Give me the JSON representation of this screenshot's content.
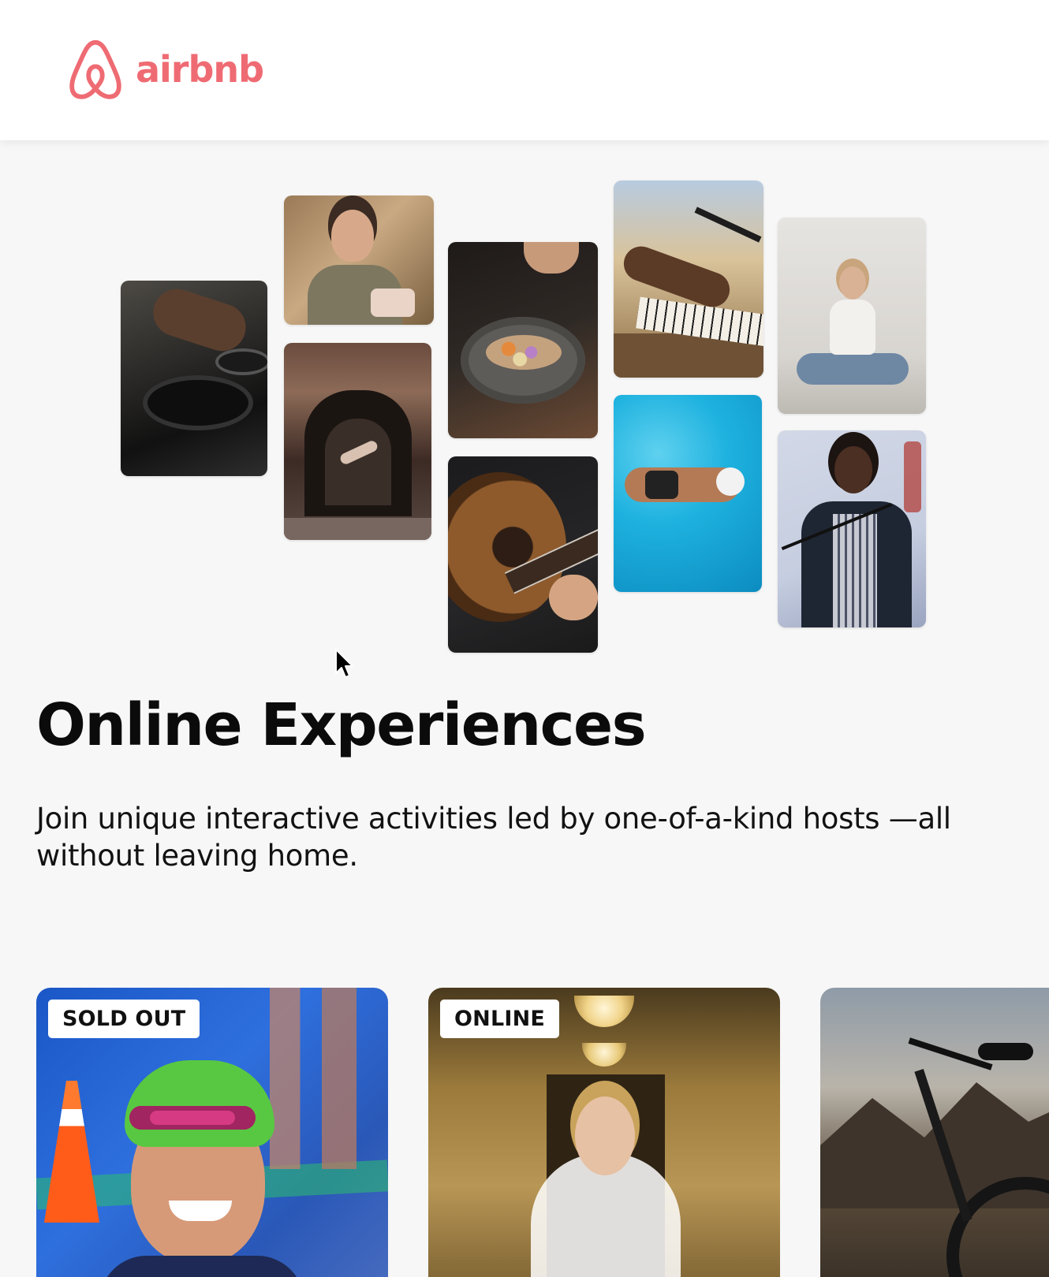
{
  "brand": {
    "name": "airbnb",
    "color": "#ef6b73"
  },
  "collage": {
    "tiles": [
      {
        "subject": "cooking"
      },
      {
        "subject": "baking"
      },
      {
        "subject": "dance"
      },
      {
        "subject": "food"
      },
      {
        "subject": "guitar"
      },
      {
        "subject": "piano"
      },
      {
        "subject": "swimming"
      },
      {
        "subject": "yoga"
      },
      {
        "subject": "singing"
      }
    ]
  },
  "hero": {
    "title": "Online Experiences",
    "subtitle": "Join unique interactive activities led by one-of-a-kind hosts —all without leaving home."
  },
  "cards": [
    {
      "badge": "SOLD OUT"
    },
    {
      "badge": "ONLINE"
    },
    {
      "badge": ""
    }
  ],
  "icons": {
    "logo": "airbnb-belo-icon",
    "cursor": "mouse-pointer-icon"
  }
}
